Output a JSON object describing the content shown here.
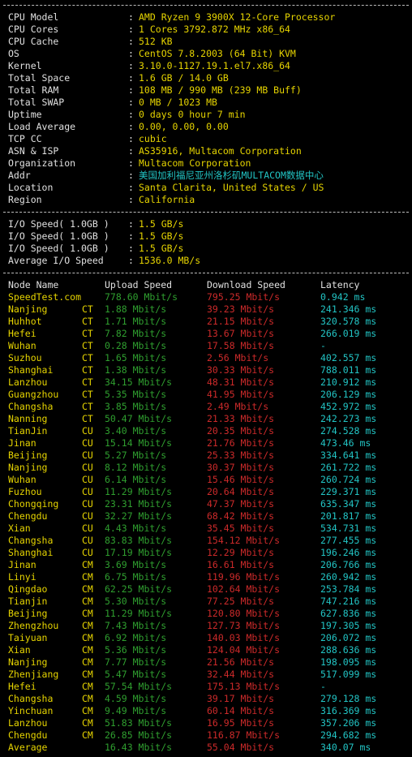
{
  "system": [
    [
      "CPU Model",
      "AMD Ryzen 9 3900X 12-Core Processor"
    ],
    [
      "CPU Cores",
      "1 Cores 3792.872 MHz x86_64"
    ],
    [
      "CPU Cache",
      "512 KB"
    ],
    [
      "OS",
      "CentOS 7.8.2003 (64 Bit) KVM"
    ],
    [
      "Kernel",
      "3.10.0-1127.19.1.el7.x86_64"
    ],
    [
      "Total Space",
      "1.6 GB / 14.0 GB"
    ],
    [
      "Total RAM",
      "108 MB / 990 MB (239 MB Buff)"
    ],
    [
      "Total SWAP",
      "0 MB / 1023 MB"
    ],
    [
      "Uptime",
      "0 days 0 hour 7 min"
    ],
    [
      "Load Average",
      "0.00, 0.00, 0.00"
    ],
    [
      "TCP CC",
      "cubic"
    ],
    [
      "ASN & ISP",
      "AS35916, Multacom Corporation"
    ],
    [
      "Organization",
      "Multacom Corporation"
    ],
    [
      "Addr",
      "美国加利福尼亚州洛杉矶MULTACOM数据中心"
    ],
    [
      "Location",
      "Santa Clarita, United States / US"
    ],
    [
      "Region",
      "California"
    ]
  ],
  "io": [
    [
      "I/O Speed( 1.0GB )",
      "1.5 GB/s"
    ],
    [
      "I/O Speed( 1.0GB )",
      "1.5 GB/s"
    ],
    [
      "I/O Speed( 1.0GB )",
      "1.5 GB/s"
    ],
    [
      "Average I/O Speed",
      "1536.0 MB/s"
    ]
  ],
  "speed_header": [
    "Node Name",
    "Upload Speed",
    "Download Speed",
    "Latency"
  ],
  "speed_rows": [
    [
      "SpeedTest.com",
      "",
      "778.60 Mbit/s",
      "795.25 Mbit/s",
      "0.942 ms"
    ],
    [
      "Nanjing",
      "CT",
      "1.88 Mbit/s",
      "39.23 Mbit/s",
      "241.346 ms"
    ],
    [
      "Huhhot",
      "CT",
      "1.71 Mbit/s",
      "21.15 Mbit/s",
      "320.578 ms"
    ],
    [
      "Hefei",
      "CT",
      "7.82 Mbit/s",
      "13.67 Mbit/s",
      "266.019 ms"
    ],
    [
      "Wuhan",
      "CT",
      "0.28 Mbit/s",
      "17.58 Mbit/s",
      "-"
    ],
    [
      "Suzhou",
      "CT",
      "1.65 Mbit/s",
      "2.56 Mbit/s",
      "402.557 ms"
    ],
    [
      "Shanghai",
      "CT",
      "1.38 Mbit/s",
      "30.33 Mbit/s",
      "788.011 ms"
    ],
    [
      "Lanzhou",
      "CT",
      "34.15 Mbit/s",
      "48.31 Mbit/s",
      "210.912 ms"
    ],
    [
      "Guangzhou",
      "CT",
      "5.35 Mbit/s",
      "41.95 Mbit/s",
      "206.129 ms"
    ],
    [
      "Changsha",
      "CT",
      "3.85 Mbit/s",
      "2.49 Mbit/s",
      "452.972 ms"
    ],
    [
      "Nanning",
      "CT",
      "50.47 Mbit/s",
      "21.33 Mbit/s",
      "242.273 ms"
    ],
    [
      "TianJin",
      "CU",
      "3.40 Mbit/s",
      "20.35 Mbit/s",
      "274.528 ms"
    ],
    [
      "Jinan",
      "CU",
      "15.14 Mbit/s",
      "21.76 Mbit/s",
      "473.46 ms"
    ],
    [
      "Beijing",
      "CU",
      "5.27 Mbit/s",
      "25.33 Mbit/s",
      "334.641 ms"
    ],
    [
      "Nanjing",
      "CU",
      "8.12 Mbit/s",
      "30.37 Mbit/s",
      "261.722 ms"
    ],
    [
      "Wuhan",
      "CU",
      "6.14 Mbit/s",
      "15.46 Mbit/s",
      "260.724 ms"
    ],
    [
      "Fuzhou",
      "CU",
      "11.29 Mbit/s",
      "20.64 Mbit/s",
      "229.371 ms"
    ],
    [
      "Chongqing",
      "CU",
      "23.31 Mbit/s",
      "47.37 Mbit/s",
      "635.347 ms"
    ],
    [
      "Chengdu",
      "CU",
      "32.27 Mbit/s",
      "68.42 Mbit/s",
      "201.817 ms"
    ],
    [
      "Xian",
      "CU",
      "4.43 Mbit/s",
      "35.45 Mbit/s",
      "534.731 ms"
    ],
    [
      "Changsha",
      "CU",
      "83.83 Mbit/s",
      "154.12 Mbit/s",
      "277.455 ms"
    ],
    [
      "Shanghai",
      "CU",
      "17.19 Mbit/s",
      "12.29 Mbit/s",
      "196.246 ms"
    ],
    [
      "Jinan",
      "CM",
      "3.69 Mbit/s",
      "16.61 Mbit/s",
      "206.766 ms"
    ],
    [
      "Linyi",
      "CM",
      "6.75 Mbit/s",
      "119.96 Mbit/s",
      "260.942 ms"
    ],
    [
      "Qingdao",
      "CM",
      "62.25 Mbit/s",
      "102.64 Mbit/s",
      "253.784 ms"
    ],
    [
      "Tianjin",
      "CM",
      "5.30 Mbit/s",
      "77.25 Mbit/s",
      "747.216 ms"
    ],
    [
      "Beijing",
      "CM",
      "11.29 Mbit/s",
      "120.80 Mbit/s",
      "627.836 ms"
    ],
    [
      "Zhengzhou",
      "CM",
      "7.43 Mbit/s",
      "127.73 Mbit/s",
      "197.305 ms"
    ],
    [
      "Taiyuan",
      "CM",
      "6.92 Mbit/s",
      "140.03 Mbit/s",
      "206.072 ms"
    ],
    [
      "Xian",
      "CM",
      "5.36 Mbit/s",
      "124.04 Mbit/s",
      "288.636 ms"
    ],
    [
      "Nanjing",
      "CM",
      "7.77 Mbit/s",
      "21.56 Mbit/s",
      "198.095 ms"
    ],
    [
      "Zhenjiang",
      "CM",
      "5.47 Mbit/s",
      "32.44 Mbit/s",
      "517.099 ms"
    ],
    [
      "Hefei",
      "CM",
      "57.54 Mbit/s",
      "175.13 Mbit/s",
      "-"
    ],
    [
      "Changsha",
      "CM",
      "4.59 Mbit/s",
      "39.17 Mbit/s",
      "279.128 ms"
    ],
    [
      "Yinchuan",
      "CM",
      "9.49 Mbit/s",
      "60.14 Mbit/s",
      "316.369 ms"
    ],
    [
      "Lanzhou",
      "CM",
      "51.83 Mbit/s",
      "16.95 Mbit/s",
      "357.206 ms"
    ],
    [
      "Chengdu",
      "CM",
      "26.85 Mbit/s",
      "116.87 Mbit/s",
      "294.682 ms"
    ],
    [
      "Average",
      "",
      "16.43 Mbit/s",
      "55.04 Mbit/s",
      "340.07 ms"
    ]
  ],
  "colors": {
    "background": "#000000",
    "label": "#e0e0e0",
    "value": "#e6d400",
    "addr": "#22c4c4",
    "upload": "#2f9f2f",
    "download": "#cc2a2a"
  }
}
